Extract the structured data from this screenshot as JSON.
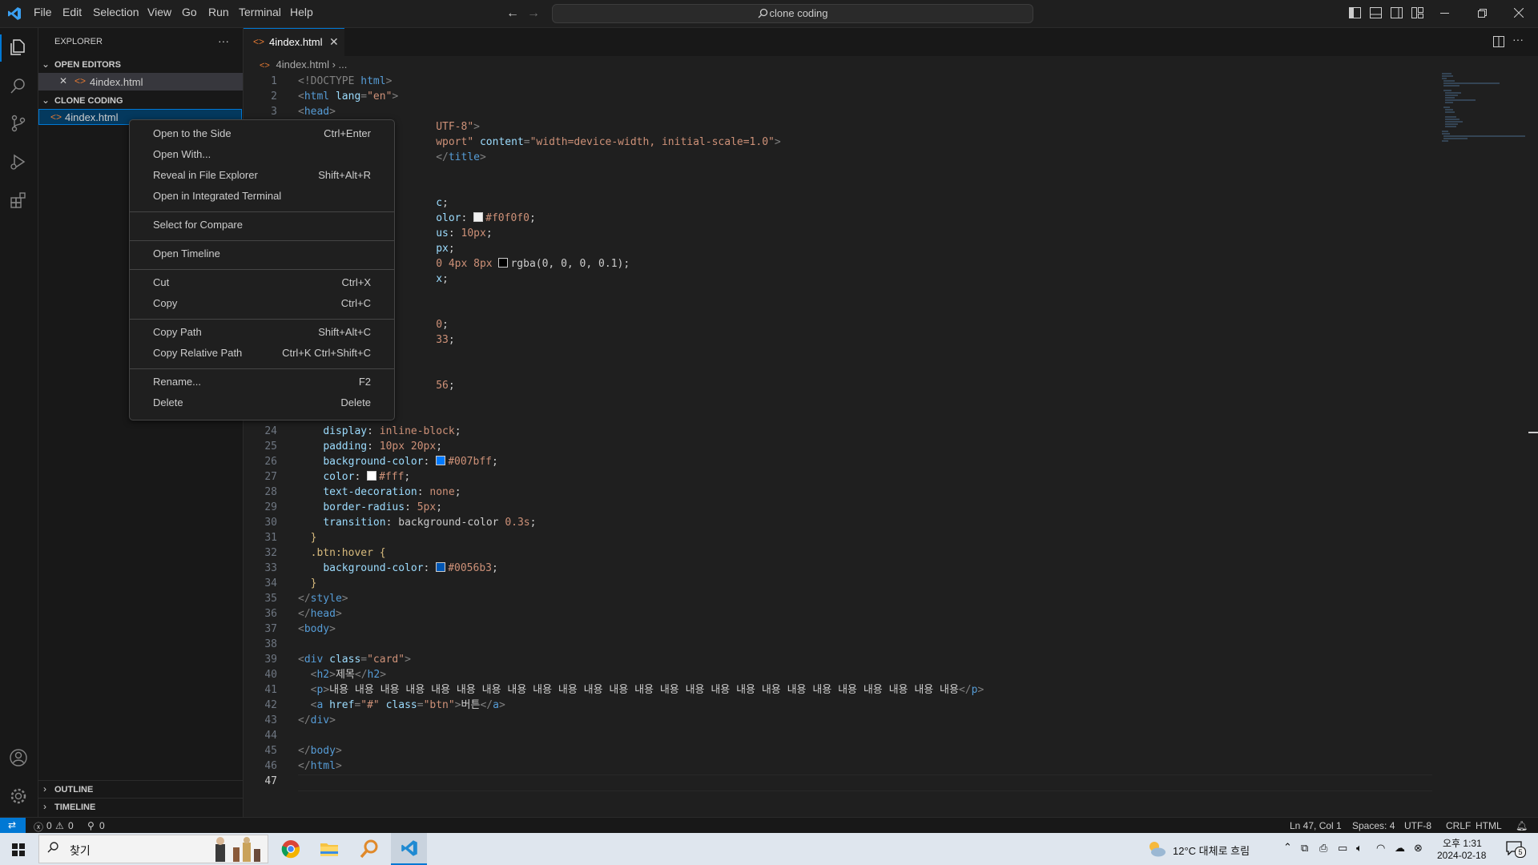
{
  "window": {
    "menu": [
      "File",
      "Edit",
      "Selection",
      "View",
      "Go",
      "Run",
      "Terminal",
      "Help"
    ],
    "search_text": "clone coding"
  },
  "sidebar": {
    "title": "EXPLORER",
    "more": "···",
    "open_editors_label": "OPEN EDITORS",
    "open_editor_file": "4index.html",
    "folder_label": "CLONE CODING",
    "folder_file": "4index.html",
    "outline_label": "OUTLINE",
    "timeline_label": "TIMELINE"
  },
  "editor": {
    "tab_label": "4index.html",
    "breadcrumb_file": "4index.html",
    "breadcrumb_rest": "...",
    "lines": [
      {
        "n": "1",
        "parts": [
          [
            "pun",
            "<!DOCTYPE "
          ],
          [
            "tag",
            "html"
          ],
          [
            "pun",
            ">"
          ]
        ]
      },
      {
        "n": "2",
        "parts": [
          [
            "pun",
            "<"
          ],
          [
            "tag",
            "html "
          ],
          [
            "attr",
            "lang"
          ],
          [
            "pun",
            "="
          ],
          [
            "str",
            "\"en\""
          ],
          [
            "pun",
            ">"
          ]
        ]
      },
      {
        "n": "3",
        "parts": [
          [
            "pun",
            "<"
          ],
          [
            "tag",
            "head"
          ],
          [
            "pun",
            ">"
          ]
        ]
      },
      {
        "n": "4",
        "parts": [
          [
            "txt",
            "                      "
          ],
          [
            "str",
            "UTF-8\""
          ],
          [
            "pun",
            ">"
          ]
        ]
      },
      {
        "n": "5",
        "parts": [
          [
            "txt",
            "                      "
          ],
          [
            "str",
            "wport\""
          ],
          [
            "txt",
            " "
          ],
          [
            "attr",
            "content"
          ],
          [
            "pun",
            "="
          ],
          [
            "str",
            "\"width=device-width, initial-scale=1.0\""
          ],
          [
            "pun",
            ">"
          ]
        ]
      },
      {
        "n": "6",
        "parts": [
          [
            "txt",
            "                      "
          ],
          [
            "pun",
            "</"
          ],
          [
            "tag",
            "title"
          ],
          [
            "pun",
            ">"
          ]
        ]
      },
      {
        "n": "7",
        "parts": []
      },
      {
        "n": "8",
        "parts": []
      },
      {
        "n": "9",
        "parts": [
          [
            "txt",
            "                      "
          ],
          [
            "prop",
            "c"
          ],
          [
            "txt",
            ";"
          ]
        ]
      },
      {
        "n": "10",
        "parts": [
          [
            "txt",
            "                      "
          ],
          [
            "prop",
            "olor"
          ],
          [
            "txt",
            ": "
          ],
          [
            "sw",
            "#f0f0f0"
          ],
          [
            "str",
            "#f0f0f0"
          ],
          [
            "txt",
            ";"
          ]
        ]
      },
      {
        "n": "11",
        "parts": [
          [
            "txt",
            "                      "
          ],
          [
            "prop",
            "us"
          ],
          [
            "txt",
            ": "
          ],
          [
            "str",
            "10px"
          ],
          [
            "txt",
            ";"
          ]
        ]
      },
      {
        "n": "12",
        "parts": [
          [
            "txt",
            "                      "
          ],
          [
            "prop",
            "px"
          ],
          [
            "txt",
            ";"
          ]
        ]
      },
      {
        "n": "13",
        "parts": [
          [
            "txt",
            "                      "
          ],
          [
            "str",
            "0 4px 8px "
          ],
          [
            "sw",
            "#000000"
          ],
          [
            "txt",
            "rgba(0, 0, 0, 0.1);"
          ]
        ]
      },
      {
        "n": "14",
        "parts": [
          [
            "txt",
            "                      "
          ],
          [
            "prop",
            "x"
          ],
          [
            "txt",
            ";"
          ]
        ]
      },
      {
        "n": "15",
        "parts": []
      },
      {
        "n": "16",
        "parts": []
      },
      {
        "n": "17",
        "parts": [
          [
            "txt",
            "                      "
          ],
          [
            "str",
            "0"
          ],
          [
            "txt",
            ";"
          ]
        ]
      },
      {
        "n": "18",
        "parts": [
          [
            "txt",
            "                      "
          ],
          [
            "str",
            "33"
          ],
          [
            "txt",
            ";"
          ]
        ]
      },
      {
        "n": "19",
        "parts": []
      },
      {
        "n": "20",
        "parts": []
      },
      {
        "n": "21",
        "parts": [
          [
            "txt",
            "                      "
          ],
          [
            "str",
            "56"
          ],
          [
            "txt",
            ";"
          ]
        ]
      },
      {
        "n": "22",
        "parts": []
      },
      {
        "n": "23",
        "parts": []
      },
      {
        "n": "24",
        "parts": [
          [
            "txt",
            "    "
          ],
          [
            "prop",
            "display"
          ],
          [
            "txt",
            ": "
          ],
          [
            "str",
            "inline-block"
          ],
          [
            "txt",
            ";"
          ]
        ]
      },
      {
        "n": "25",
        "parts": [
          [
            "txt",
            "    "
          ],
          [
            "prop",
            "padding"
          ],
          [
            "txt",
            ": "
          ],
          [
            "str",
            "10px 20px"
          ],
          [
            "txt",
            ";"
          ]
        ]
      },
      {
        "n": "26",
        "parts": [
          [
            "txt",
            "    "
          ],
          [
            "prop",
            "background-color"
          ],
          [
            "txt",
            ": "
          ],
          [
            "sw",
            "#007bff"
          ],
          [
            "str",
            "#007bff"
          ],
          [
            "txt",
            ";"
          ]
        ]
      },
      {
        "n": "27",
        "parts": [
          [
            "txt",
            "    "
          ],
          [
            "prop",
            "color"
          ],
          [
            "txt",
            ": "
          ],
          [
            "sw",
            "#ffffff"
          ],
          [
            "str",
            "#fff"
          ],
          [
            "txt",
            ";"
          ]
        ]
      },
      {
        "n": "28",
        "parts": [
          [
            "txt",
            "    "
          ],
          [
            "prop",
            "text-decoration"
          ],
          [
            "txt",
            ": "
          ],
          [
            "str",
            "none"
          ],
          [
            "txt",
            ";"
          ]
        ]
      },
      {
        "n": "29",
        "parts": [
          [
            "txt",
            "    "
          ],
          [
            "prop",
            "border-radius"
          ],
          [
            "txt",
            ": "
          ],
          [
            "str",
            "5px"
          ],
          [
            "txt",
            ";"
          ]
        ]
      },
      {
        "n": "30",
        "parts": [
          [
            "txt",
            "    "
          ],
          [
            "prop",
            "transition"
          ],
          [
            "txt",
            ": background-color "
          ],
          [
            "str",
            "0.3s"
          ],
          [
            "txt",
            ";"
          ]
        ]
      },
      {
        "n": "31",
        "parts": [
          [
            "txt",
            "  "
          ],
          [
            "sel",
            "}"
          ]
        ]
      },
      {
        "n": "32",
        "parts": [
          [
            "txt",
            "  "
          ],
          [
            "sel",
            ".btn:hover"
          ],
          [
            "txt",
            " "
          ],
          [
            "sel",
            "{"
          ]
        ]
      },
      {
        "n": "33",
        "parts": [
          [
            "txt",
            "    "
          ],
          [
            "prop",
            "background-color"
          ],
          [
            "txt",
            ": "
          ],
          [
            "sw",
            "#0056b3"
          ],
          [
            "str",
            "#0056b3"
          ],
          [
            "txt",
            ";"
          ]
        ]
      },
      {
        "n": "34",
        "parts": [
          [
            "txt",
            "  "
          ],
          [
            "sel",
            "}"
          ]
        ]
      },
      {
        "n": "35",
        "parts": [
          [
            "pun",
            "</"
          ],
          [
            "tag",
            "style"
          ],
          [
            "pun",
            ">"
          ]
        ]
      },
      {
        "n": "36",
        "parts": [
          [
            "pun",
            "</"
          ],
          [
            "tag",
            "head"
          ],
          [
            "pun",
            ">"
          ]
        ]
      },
      {
        "n": "37",
        "parts": [
          [
            "pun",
            "<"
          ],
          [
            "tag",
            "body"
          ],
          [
            "pun",
            ">"
          ]
        ]
      },
      {
        "n": "38",
        "parts": []
      },
      {
        "n": "39",
        "parts": [
          [
            "pun",
            "<"
          ],
          [
            "tag",
            "div "
          ],
          [
            "attr",
            "class"
          ],
          [
            "pun",
            "="
          ],
          [
            "str",
            "\"card\""
          ],
          [
            "pun",
            ">"
          ]
        ]
      },
      {
        "n": "40",
        "parts": [
          [
            "txt",
            "  "
          ],
          [
            "pun",
            "<"
          ],
          [
            "tag",
            "h2"
          ],
          [
            "pun",
            ">"
          ],
          [
            "txt",
            "제목"
          ],
          [
            "pun",
            "</"
          ],
          [
            "tag",
            "h2"
          ],
          [
            "pun",
            ">"
          ]
        ]
      },
      {
        "n": "41",
        "parts": [
          [
            "txt",
            "  "
          ],
          [
            "pun",
            "<"
          ],
          [
            "tag",
            "p"
          ],
          [
            "pun",
            ">"
          ],
          [
            "txt",
            "내용 내용 내용 내용 내용 내용 내용 내용 내용 내용 내용 내용 내용 내용 내용 내용 내용 내용 내용 내용 내용 내용 내용 내용 내용"
          ],
          [
            "pun",
            "</"
          ],
          [
            "tag",
            "p"
          ],
          [
            "pun",
            ">"
          ]
        ]
      },
      {
        "n": "42",
        "parts": [
          [
            "txt",
            "  "
          ],
          [
            "pun",
            "<"
          ],
          [
            "tag",
            "a "
          ],
          [
            "attr",
            "href"
          ],
          [
            "pun",
            "="
          ],
          [
            "str",
            "\"#\""
          ],
          [
            "txt",
            " "
          ],
          [
            "attr",
            "class"
          ],
          [
            "pun",
            "="
          ],
          [
            "str",
            "\"btn\""
          ],
          [
            "pun",
            ">"
          ],
          [
            "txt",
            "버튼"
          ],
          [
            "pun",
            "</"
          ],
          [
            "tag",
            "a"
          ],
          [
            "pun",
            ">"
          ]
        ]
      },
      {
        "n": "43",
        "parts": [
          [
            "pun",
            "</"
          ],
          [
            "tag",
            "div"
          ],
          [
            "pun",
            ">"
          ]
        ]
      },
      {
        "n": "44",
        "parts": []
      },
      {
        "n": "45",
        "parts": [
          [
            "pun",
            "</"
          ],
          [
            "tag",
            "body"
          ],
          [
            "pun",
            ">"
          ]
        ]
      },
      {
        "n": "46",
        "parts": [
          [
            "pun",
            "</"
          ],
          [
            "tag",
            "html"
          ],
          [
            "pun",
            ">"
          ]
        ]
      },
      {
        "n": "47",
        "parts": []
      }
    ]
  },
  "context_menu": {
    "groups": [
      [
        {
          "label": "Open to the Side",
          "key": "Ctrl+Enter"
        },
        {
          "label": "Open With...",
          "key": ""
        },
        {
          "label": "Reveal in File Explorer",
          "key": "Shift+Alt+R"
        },
        {
          "label": "Open in Integrated Terminal",
          "key": ""
        }
      ],
      [
        {
          "label": "Select for Compare",
          "key": ""
        }
      ],
      [
        {
          "label": "Open Timeline",
          "key": ""
        }
      ],
      [
        {
          "label": "Cut",
          "key": "Ctrl+X"
        },
        {
          "label": "Copy",
          "key": "Ctrl+C"
        }
      ],
      [
        {
          "label": "Copy Path",
          "key": "Shift+Alt+C"
        },
        {
          "label": "Copy Relative Path",
          "key": "Ctrl+K Ctrl+Shift+C"
        }
      ],
      [
        {
          "label": "Rename...",
          "key": "F2"
        },
        {
          "label": "Delete",
          "key": "Delete"
        }
      ]
    ]
  },
  "statusbar": {
    "errors": "0",
    "warnings": "0",
    "ports": "0",
    "position": "Ln 47, Col 1",
    "spaces": "Spaces: 4",
    "encoding": "UTF-8",
    "eol": "CRLF",
    "language": "HTML"
  },
  "taskbar": {
    "search_placeholder": "찾기",
    "weather": "12°C 대체로 흐림",
    "time": "오후 1:31",
    "date": "2024-02-18",
    "notifications": "5"
  },
  "colors": {
    "accent": "#0078d4",
    "statusbar_remote": "#0078d4"
  }
}
